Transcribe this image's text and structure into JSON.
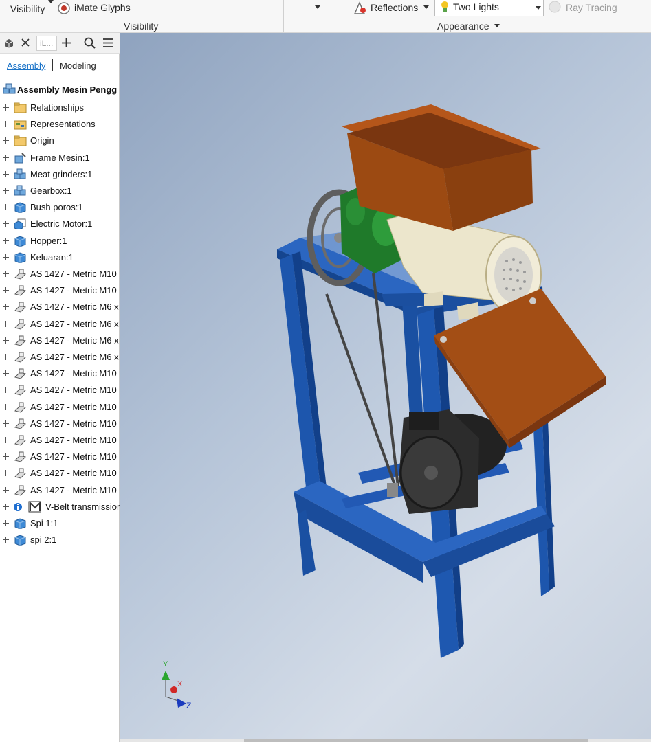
{
  "ribbon": {
    "visibility_label": "Visibility",
    "imate_glyphs_label": "iMate Glyphs",
    "visibility_group": "Visibility",
    "reflections_label": "Reflections",
    "lighting_value": "Two Lights",
    "ray_tracing_label": "Ray Tracing",
    "appearance_group": "Appearance"
  },
  "browser": {
    "tab_label": "iL...",
    "mode_assembly": "Assembly",
    "mode_modeling": "Modeling",
    "root": "Assembly Mesin Pengg",
    "items": [
      {
        "label": "Relationships",
        "icon": "folder-icon"
      },
      {
        "label": "Representations",
        "icon": "representations-icon"
      },
      {
        "label": "Origin",
        "icon": "folder-icon"
      },
      {
        "label": "Frame Mesin:1",
        "icon": "weldment-icon"
      },
      {
        "label": "Meat grinders:1",
        "icon": "subassembly-icon"
      },
      {
        "label": "Gearbox:1",
        "icon": "subassembly-icon"
      },
      {
        "label": "Bush poros:1",
        "icon": "part-icon"
      },
      {
        "label": "Electric Motor:1",
        "icon": "derived-part-icon"
      },
      {
        "label": "Hopper:1",
        "icon": "part-icon"
      },
      {
        "label": "Keluaran:1",
        "icon": "part-icon"
      },
      {
        "label": "AS 1427 - Metric M10",
        "icon": "fastener-icon"
      },
      {
        "label": "AS 1427 - Metric M10",
        "icon": "fastener-icon"
      },
      {
        "label": "AS 1427 - Metric M6 x",
        "icon": "fastener-icon"
      },
      {
        "label": "AS 1427 - Metric M6 x",
        "icon": "fastener-icon"
      },
      {
        "label": "AS 1427 - Metric M6 x",
        "icon": "fastener-icon"
      },
      {
        "label": "AS 1427 - Metric M6 x",
        "icon": "fastener-icon"
      },
      {
        "label": "AS 1427 - Metric M10",
        "icon": "fastener-icon"
      },
      {
        "label": "AS 1427 - Metric M10",
        "icon": "fastener-icon"
      },
      {
        "label": "AS 1427 - Metric M10",
        "icon": "fastener-icon"
      },
      {
        "label": "AS 1427 - Metric M10",
        "icon": "fastener-icon"
      },
      {
        "label": "AS 1427 - Metric M10",
        "icon": "fastener-icon"
      },
      {
        "label": "AS 1427 - Metric M10",
        "icon": "fastener-icon"
      },
      {
        "label": "AS 1427 - Metric M10",
        "icon": "fastener-icon"
      },
      {
        "label": "AS 1427 - Metric M10",
        "icon": "fastener-icon"
      },
      {
        "label": "V-Belt transmission",
        "icon": "design-accelerator-icon"
      },
      {
        "label": "Spi 1:1",
        "icon": "part-icon"
      },
      {
        "label": "spi 2:1",
        "icon": "part-icon"
      }
    ]
  },
  "viewcube": {
    "x_label": "X",
    "y_label": "Y",
    "z_label": "Z"
  },
  "colors": {
    "frame": "#1e55a8",
    "hopper": "#9c4a12",
    "gearbox": "#1f7a2a",
    "grinder": "#e9e2c8",
    "accent": "#1a73c8"
  }
}
